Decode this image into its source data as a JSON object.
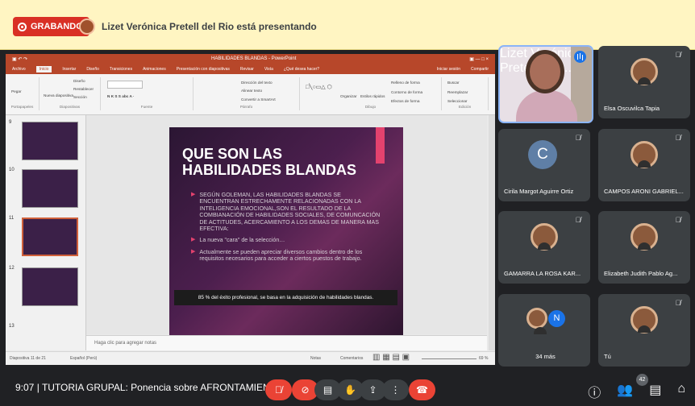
{
  "recording": {
    "label": "GRABANDO"
  },
  "presenter": {
    "text": "Lizet Verónica Pretell del Rio está presentando"
  },
  "powerpoint": {
    "title": "HABILIDADES BLANDAS - PowerPoint",
    "tabs": [
      "Archivo",
      "Inicio",
      "Insertar",
      "Diseño",
      "Transiciones",
      "Animaciones",
      "Presentación con diapositivas",
      "Revisar",
      "Vista",
      "¿Qué desea hacer?"
    ],
    "account": "Iniciar sesión",
    "share": "Compartir",
    "groups": [
      "Portapapeles",
      "Diapositivas",
      "Fuente",
      "Párrafo",
      "Dibujo",
      "Edición"
    ],
    "ribbon_labels": [
      "Pegar",
      "Nueva diapositiva",
      "Diseño",
      "Restablecer",
      "Sección",
      "Dirección del texto",
      "Alinear texto",
      "Convertir a SmartArt",
      "Organizar",
      "Estilos rápidos",
      "Relleno de forma",
      "Contorno de forma",
      "Efectos de forma",
      "Buscar",
      "Reemplazar",
      "Seleccionar"
    ],
    "thumbnail_numbers": [
      "9",
      "10",
      "11",
      "12",
      "13"
    ],
    "slide": {
      "title": "QUE SON LAS HABILIDADES BLANDAS",
      "bullets": [
        "SEGÚN GOLEMAN, LAS HABILIDADES BLANDAS SE ENCUENTRAN ESTRECHAMENTE RELACIONADAS CON LA INTELIGENCIA EMOCIONAL,SON EL RESULTADO DE LA COMBIANACIÓN DE HABILIDADES SOCIALES, DE COMUNCACIÓN DE ACTITUDES, ACERCAMIENTO A LOS DEMAS DE MANERA MAS EFECTIVA:",
        "La nueva \"cara\" de la selección…",
        "Actualmente se pueden apreciar diversos cambios dentro de los requisitos necesarios para acceder a ciertos puestos de trabajo."
      ],
      "footer": "85 % del éxito profesional, se basa en la adquisición de habilidades blandas."
    },
    "notes_placeholder": "Haga clic para agregar notas",
    "status": {
      "slide": "Diapositiva 11 de 21",
      "language": "Español (Perú)",
      "notes": "Notas",
      "comments": "Comentarios",
      "zoom": "69 %"
    }
  },
  "participants": [
    {
      "name": "Lizet Verónica Pretell del ..."
    },
    {
      "name": "Elsa Oscuvilca Tapia"
    },
    {
      "name": "Cirila Margot Aguirre Ortiz",
      "initial": "C"
    },
    {
      "name": "CAMPOS ARONI GABRIEL..."
    },
    {
      "name": "GAMARRA LA ROSA KAR..."
    },
    {
      "name": "Elizabeth Judith Pablo Ag..."
    },
    {
      "name": "34 más",
      "initial": "N"
    },
    {
      "name": "Tú"
    }
  ],
  "bottom": {
    "time": "9:07",
    "meeting": "TUTORIA GRUPAL: Ponencia sobre AFRONTAMIENT...",
    "participant_count": "42"
  },
  "colors": {
    "red": "#ea4335",
    "dark": "#202124",
    "ppt": "#b7472a",
    "accent": "#e3426e"
  }
}
